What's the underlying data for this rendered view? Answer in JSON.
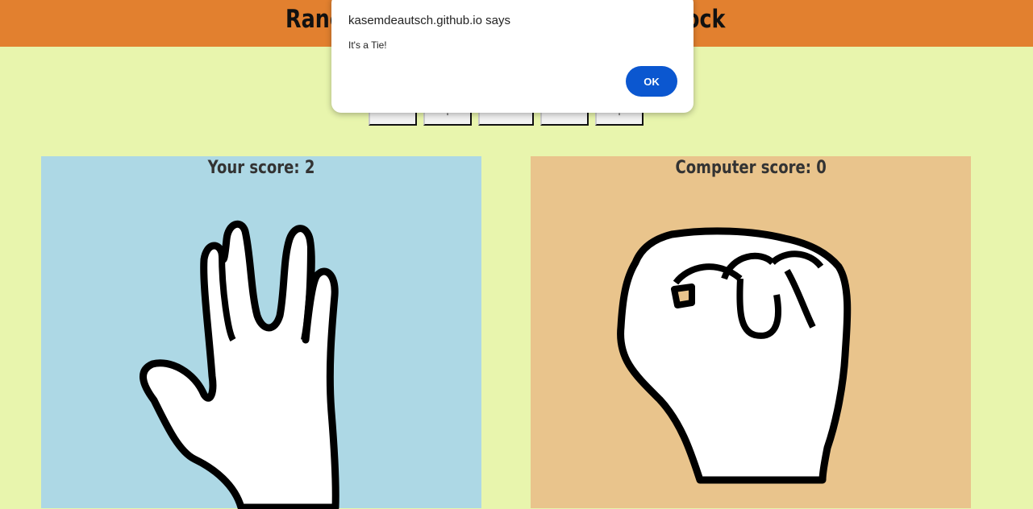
{
  "header": {
    "title_left_fragment": "Ranc",
    "title_right_fragment": "ock"
  },
  "choices": [
    {
      "label": ""
    },
    {
      "label": "'"
    },
    {
      "label": ""
    },
    {
      "label": ""
    },
    {
      "label": "'"
    }
  ],
  "player": {
    "score_label": "Your score: 2",
    "hand_icon": "spock-hand-icon"
  },
  "computer": {
    "score_label": "Computer score: 0",
    "hand_icon": "rock-fist-icon"
  },
  "dialog": {
    "title": "kasemdeautsch.github.io says",
    "message": "It's a Tie!",
    "ok_label": "OK"
  },
  "colors": {
    "header_bg": "#e2802f",
    "page_bg": "#e8f5ad",
    "player_panel_bg": "#add8e5",
    "computer_panel_bg": "#e9c48c",
    "ok_button": "#0b57d0"
  }
}
